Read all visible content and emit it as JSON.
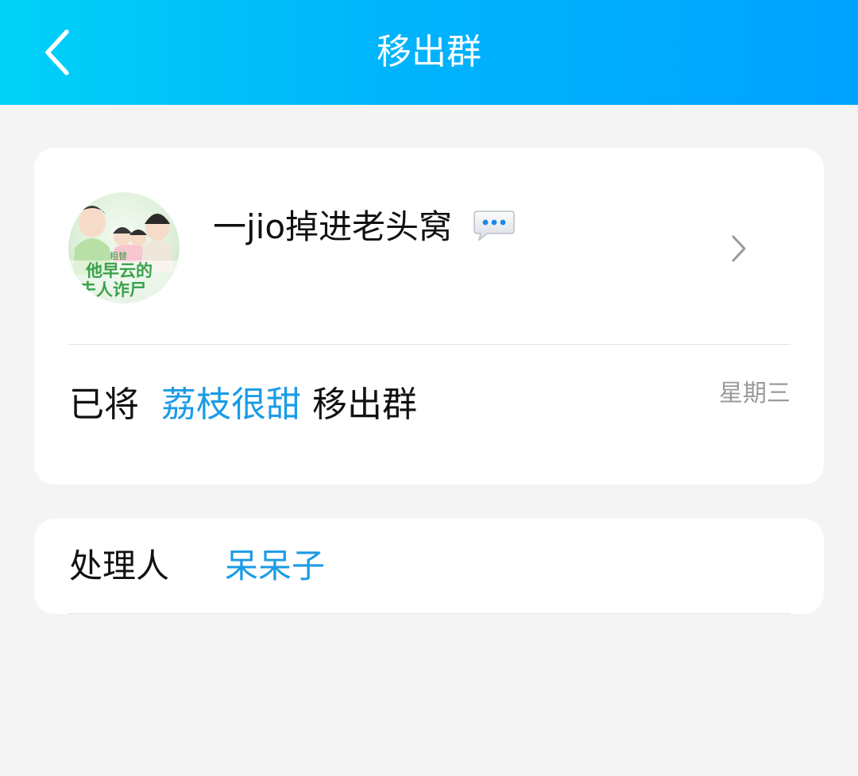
{
  "header": {
    "title": "移出群",
    "background_start": "#00d2f7",
    "background_end": "#00a3ff"
  },
  "profile": {
    "nickname": "一jio掉进老头窝",
    "avatar_text_lines": [
      "粗替",
      "他早云的",
      "夫人诈尸"
    ]
  },
  "message": {
    "prefix": "已将",
    "member": "荔枝很甜",
    "suffix": "移出群",
    "time": "星期三",
    "link_color": "#1a9be6"
  },
  "handler": {
    "label": "处理人",
    "name": "呆呆子"
  },
  "icons": {
    "back": "chevron-left-icon",
    "chat": "speech-bubble-icon",
    "arrow": "chevron-right-icon"
  }
}
